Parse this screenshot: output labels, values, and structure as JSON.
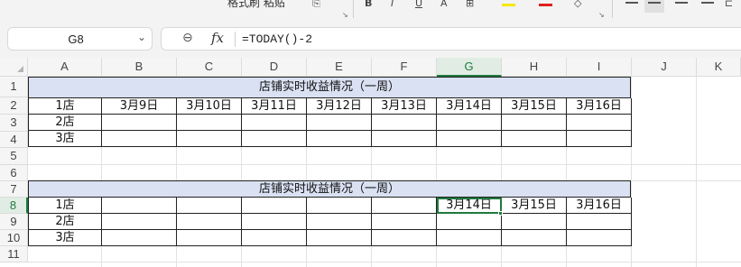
{
  "ribbon": {
    "partial_label": "格式刷 粘贴",
    "icons": [
      "paste-options-icon",
      "bold-icon",
      "italic-icon",
      "underline-icon",
      "strikethrough-icon",
      "borders-icon",
      "fill-color-icon",
      "font-color-icon",
      "clear-format-icon",
      "align-top-icon",
      "align-middle-icon",
      "align-bottom-icon",
      "wrap-text-icon"
    ],
    "colors": {
      "fill_swatch": "#f5e800",
      "font_swatch": "#e02020"
    }
  },
  "formula_bar": {
    "name_box": "G8",
    "formula": "=TODAY()-2"
  },
  "sheet": {
    "columns": [
      "A",
      "B",
      "C",
      "D",
      "E",
      "F",
      "G",
      "H",
      "I",
      "J",
      "K"
    ],
    "rows": [
      "1",
      "2",
      "3",
      "4",
      "5",
      "6",
      "7",
      "8",
      "9",
      "10",
      "11"
    ],
    "selected_column": "G",
    "selected_row": "8",
    "accent_color": "#1f7a3e",
    "title_fill": "#d9e1f2",
    "table1": {
      "title": "店铺实时收益情况（一周）",
      "header_row": [
        "1店",
        "3月9日",
        "3月10日",
        "3月11日",
        "3月12日",
        "3月13日",
        "3月14日",
        "3月15日",
        "3月16日"
      ],
      "row2": [
        "2店",
        "",
        "",
        "",
        "",
        "",
        "",
        "",
        ""
      ],
      "row3": [
        "3店",
        "",
        "",
        "",
        "",
        "",
        "",
        "",
        ""
      ]
    },
    "table2": {
      "title": "店铺实时收益情况（一周）",
      "header_row": [
        "1店",
        "",
        "",
        "",
        "",
        "",
        "3月14日",
        "3月15日",
        "3月16日"
      ],
      "row2": [
        "2店",
        "",
        "",
        "",
        "",
        "",
        "",
        "",
        ""
      ],
      "row3": [
        "3店",
        "",
        "",
        "",
        "",
        "",
        "",
        "",
        ""
      ]
    }
  }
}
